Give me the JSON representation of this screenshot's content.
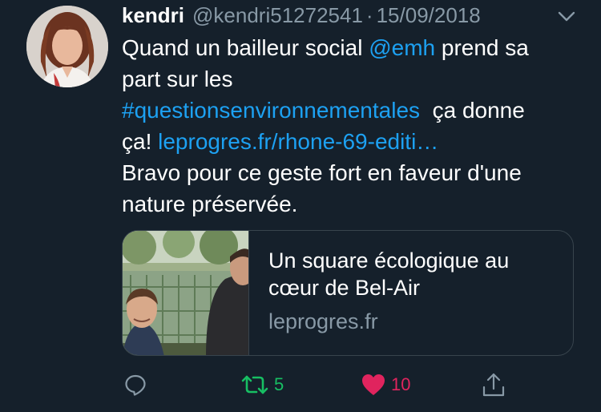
{
  "author": {
    "name": "kendri",
    "handle": "@kendri51272541",
    "separator": "·",
    "date": "15/09/2018",
    "avatar_icon": "profile-photo"
  },
  "tweet": {
    "line1_text": "Quand un bailleur social ",
    "line1_mention": "@emh",
    "line1_rest": " prend sa",
    "line2": "part sur les",
    "hashtag": "#questionsenvironnementales",
    "line3_rest": "  ça donne",
    "line4_text": "ça! ",
    "line4_link": "leprogres.fr/rhone-69-editi…",
    "line5": "Bravo pour ce geste fort en faveur d'une",
    "line6": "nature préservée."
  },
  "card": {
    "title_line1": "Un square écologique au",
    "title_line2": "cœur de Bel-Air",
    "domain": "leprogres.fr"
  },
  "actions": {
    "reply_icon": "reply-icon",
    "retweet_icon": "retweet-icon",
    "retweet_count": "5",
    "like_icon": "heart-icon",
    "like_count": "10",
    "share_icon": "share-icon"
  },
  "colors": {
    "background": "#15202b",
    "link": "#1da1f2",
    "muted": "#8899a6",
    "retweet": "#17bf63",
    "like": "#e0245e",
    "border": "#38444d"
  }
}
